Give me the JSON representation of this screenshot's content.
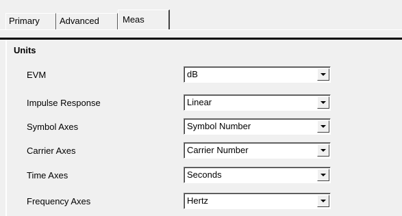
{
  "tabs": {
    "primary": "Primary",
    "advanced": "Advanced",
    "meas": "Meas",
    "selected": "Meas"
  },
  "units_group": {
    "title": "Units",
    "rows": [
      {
        "label": "EVM",
        "value": "dB"
      },
      {
        "label": "Impulse Response",
        "value": "Linear"
      },
      {
        "label": "Symbol Axes",
        "value": "Symbol Number"
      },
      {
        "label": "Carrier Axes",
        "value": "Carrier Number"
      },
      {
        "label": "Time Axes",
        "value": "Seconds"
      },
      {
        "label": "Frequency Axes",
        "value": "Hertz"
      }
    ]
  },
  "icons": {
    "dropdown": "chevron-down-icon"
  },
  "colors": {
    "panel_bg": "#f0f0f0",
    "field_bg": "#ffffff"
  }
}
